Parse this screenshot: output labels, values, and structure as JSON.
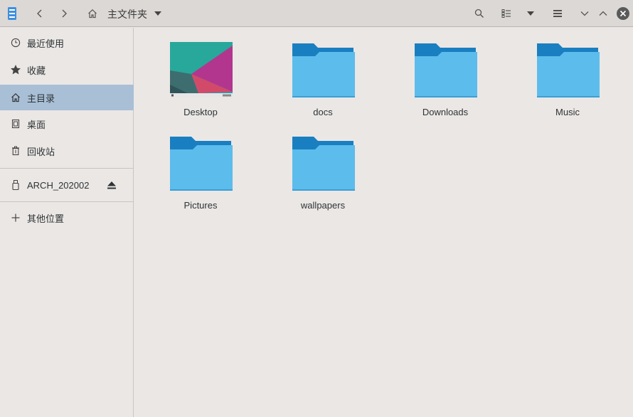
{
  "header": {
    "path_label": "主文件夹",
    "icons": [
      "app-menu-icon",
      "back-icon",
      "forward-icon",
      "home-icon",
      "path-dropdown-icon",
      "search-icon",
      "view-mode-icon",
      "view-dropdown-icon",
      "hamburger-menu-icon",
      "minimize-icon",
      "maximize-icon",
      "close-icon"
    ]
  },
  "sidebar": {
    "items": [
      {
        "label": "最近使用",
        "icon": "clock-icon"
      },
      {
        "label": "收藏",
        "icon": "star-icon"
      },
      {
        "label": "主目录",
        "icon": "home-icon",
        "active": true
      },
      {
        "label": "桌面",
        "icon": "desktop-icon"
      },
      {
        "label": "回收站",
        "icon": "trash-icon"
      }
    ],
    "devices": [
      {
        "label": "ARCH_202002",
        "icon": "usb-drive-icon",
        "action_icon": "eject-icon"
      }
    ],
    "other": [
      {
        "label": "其他位置",
        "icon": "plus-icon"
      }
    ]
  },
  "files": [
    {
      "name": "Desktop",
      "type": "folder-thumbnail"
    },
    {
      "name": "docs",
      "type": "folder"
    },
    {
      "name": "Downloads",
      "type": "folder"
    },
    {
      "name": "Music",
      "type": "folder"
    },
    {
      "name": "Pictures",
      "type": "folder"
    },
    {
      "name": "wallpapers",
      "type": "folder"
    }
  ],
  "colors": {
    "folder_back": "#1a7fc1",
    "folder_front": "#5cbcec",
    "sidebar_active": "#a8bfd6",
    "background": "#ebe7e5",
    "headerbar": "#dcd8d5"
  }
}
